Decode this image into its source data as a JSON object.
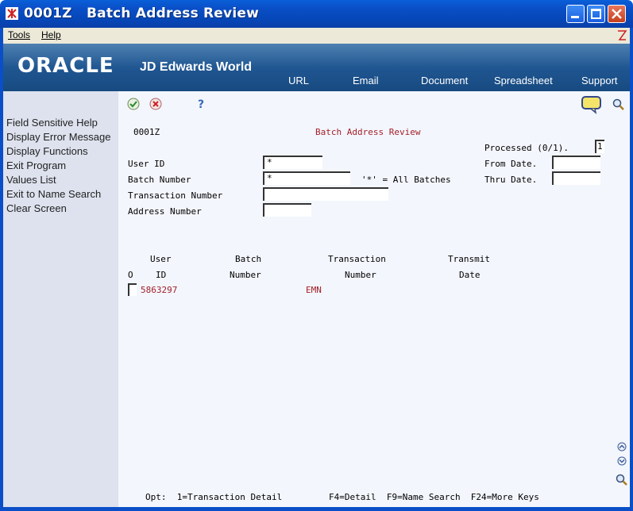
{
  "window": {
    "title": "0001Z   Batch Address Review"
  },
  "menu": {
    "tools": "Tools",
    "help": "Help"
  },
  "banner": {
    "logo": "ORACLE",
    "product": "JD Edwards World",
    "links": [
      "URL",
      "Email",
      "Document",
      "Spreadsheet",
      "Support"
    ]
  },
  "nav": {
    "items": [
      "Field Sensitive Help",
      "Display Error Message",
      "Display Functions",
      "Exit Program",
      "Values List",
      "Exit to Name Search",
      "Clear Screen"
    ]
  },
  "form": {
    "program_id": "0001Z",
    "screen_title": "Batch Address Review",
    "processed_label": "Processed (0/1).",
    "processed_value": "1",
    "from_date_label": "From Date.",
    "thru_date_label": "Thru Date.",
    "user_id_label": "User ID",
    "user_id_value": "*",
    "batch_number_label": "Batch Number",
    "batch_number_value": "*",
    "all_batches_hint": "'*' = All Batches",
    "transaction_number_label": "Transaction Number",
    "address_number_label": "Address Number"
  },
  "grid": {
    "headers": {
      "opt": "O",
      "user_top": "User",
      "user_bottom": "ID",
      "batch_top": "Batch",
      "batch_bottom": "Number",
      "trans_top": "Transaction",
      "trans_bottom": "Number",
      "transmit_top": "Transmit",
      "transmit_bottom": "Date"
    },
    "rows": [
      {
        "user_id": "5863297",
        "transaction": "EMN"
      }
    ]
  },
  "footer": {
    "opt": "Opt:  1=Transaction Detail",
    "keys": "F4=Detail  F9=Name Search  F24=More Keys"
  },
  "colors": {
    "accent": "#0a4fc7",
    "banner": "#1f5590",
    "error_red": "#a3202a"
  }
}
